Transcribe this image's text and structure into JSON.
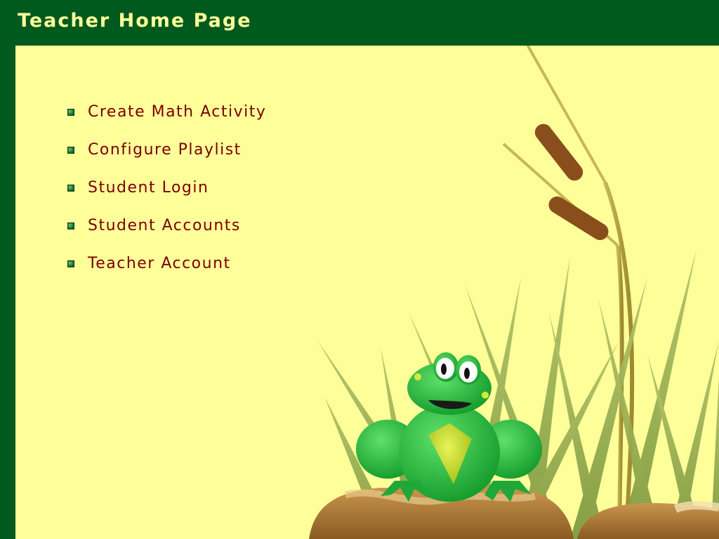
{
  "header": {
    "title": "Teacher Home Page"
  },
  "menu": {
    "items": [
      {
        "label": "Create Math Activity"
      },
      {
        "label": "Configure Playlist"
      },
      {
        "label": "Student Login"
      },
      {
        "label": "Student Accounts"
      },
      {
        "label": "Teacher Account"
      }
    ]
  },
  "colors": {
    "frame_green": "#005a1e",
    "content_yellow": "#ffff9a",
    "title_text": "#ffff9a",
    "link_text": "#7a0000"
  },
  "illustration": {
    "icons": [
      "frog-icon",
      "cattail-icon",
      "grass-icon",
      "rock-icon"
    ]
  }
}
